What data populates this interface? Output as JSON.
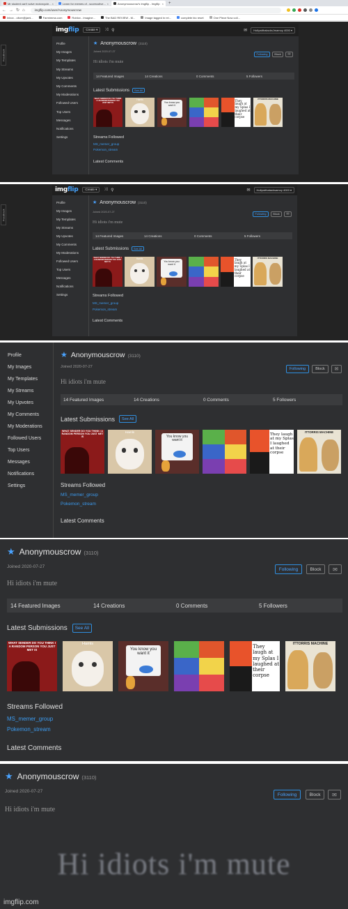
{
  "browser": {
    "tabs": [
      {
        "label": "Mr student can't solve motorcycle...",
        "color": "#d93025",
        "active": false
      },
      {
        "label": "Learn for memes of - scorecutive...",
        "color": "#4285f4",
        "active": false
      },
      {
        "label": "Anonymouscrow's Imgflip - Imgflip",
        "color": "#333333",
        "active": true
      }
    ],
    "tab_close": "×",
    "new_tab": "+",
    "url": "imgflip.com/user/Anonymouscrow",
    "bookmarks": [
      "Inbox - oliver@jami...",
      "Farmimma.com",
      "Roblox - Imagine...",
      "The BAD REVIEW - M...",
      "Image tagged in rei...",
      "complete bio reset",
      "One Piece Now coll..."
    ]
  },
  "nav": {
    "logo_img": "img",
    "logo_flip": "flip",
    "create_label": "Create ▾",
    "user_label": "HollywithatacksJmamoy 4000 ▾",
    "user_label_2": "Hollywithatacksamoy 4000 ▾",
    "feedback_label": "Feedback"
  },
  "sidebar": {
    "items": [
      "Profile",
      "My Images",
      "My Templates",
      "My Streams",
      "My Upvotes",
      "My Comments",
      "My Moderations",
      "Followed Users",
      "Top Users",
      "Messages",
      "Notifications",
      "Settings"
    ]
  },
  "profile": {
    "username": "Anonymouscrow",
    "points": "(3110)",
    "joined": "Joined 2020-07-27",
    "bio": "Hi idiots i'm mute",
    "follow_label": "Following",
    "block_label": "Block",
    "mail_icon": "mail-icon",
    "stats": [
      "14 Featured Images",
      "14 Creations",
      "0 Comments",
      "5 Followers"
    ],
    "latest_submissions": "Latest Submissions",
    "see_all": "See All",
    "streams_followed": "Streams Followed",
    "streams": [
      "MS_memer_group",
      "Pokemon_stream"
    ],
    "latest_comments": "Latest Comments"
  },
  "thumbnails": [
    {
      "name": "meme-sender-thumb",
      "caption": "WHAT SENDER DO YOU THINK I A RANDOM PERSON YOU JUST MET IS",
      "bg": "#8b1a1a"
    },
    {
      "name": "cat-thumb",
      "caption": "Hamls",
      "bg": "#d9c7a8"
    },
    {
      "name": "you-know-you-want-it-thumb",
      "caption": "You know you want it",
      "bg": "#5a2e2a"
    },
    {
      "name": "pokemon-battle-thumb",
      "caption": "",
      "bg": "#2d5f3a"
    },
    {
      "name": "magikarp-thumb",
      "caption": "They laugh at my Splas I laughed at their corpse",
      "bg": "#ffffff"
    },
    {
      "name": "doge-thumb",
      "caption": "ITTORRIS MACHINE",
      "bg": "#e9e3d3"
    }
  ],
  "zoom": {
    "big_text": "Hi idiots i'm mute",
    "watermark": "imgflip.com"
  },
  "colors": {
    "accent": "#4aa3ff",
    "bg_dark": "#2e2f31",
    "nav": "#1f1f1f"
  }
}
